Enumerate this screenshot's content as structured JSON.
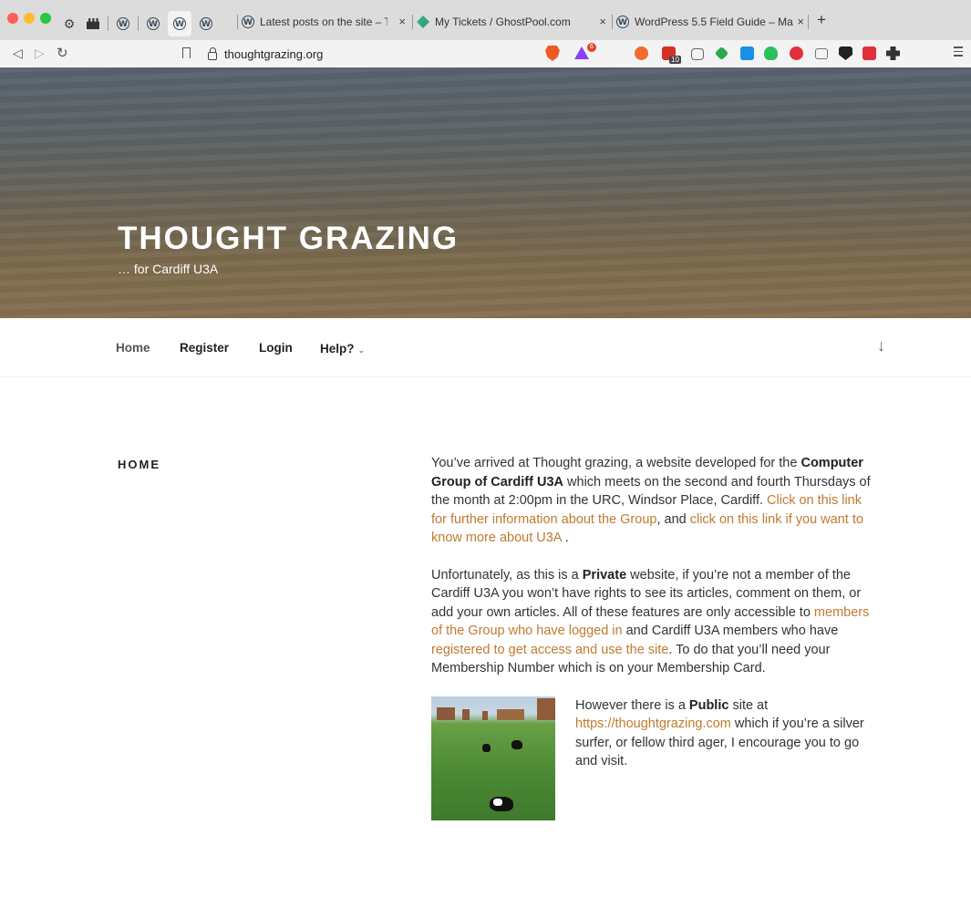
{
  "browser": {
    "tabs": [
      {
        "title": "Latest posts on the site – Thoug",
        "close": "×"
      },
      {
        "title": "My Tickets / GhostPool.com",
        "close": "×"
      },
      {
        "title": "WordPress 5.5 Field Guide – Ma",
        "close": "×"
      }
    ],
    "new_tab": "+",
    "url": "thoughtgrazing.org",
    "rewards_badge": "6",
    "ext_badge": "10"
  },
  "site": {
    "title": "THOUGHT GRAZING",
    "description": "… for Cardiff U3A"
  },
  "nav": {
    "items": [
      {
        "label": "Home"
      },
      {
        "label": "Register"
      },
      {
        "label": "Login"
      },
      {
        "label": "Help?"
      }
    ],
    "help_chevron": "⌄",
    "scroll_arrow": "↓"
  },
  "page": {
    "heading": "HOME",
    "p1": {
      "t1": "You’ve arrived at Thought grazing, a website developed for the ",
      "b1": "Computer Group of Cardiff U3A",
      "t2": " which meets on the second and fourth Thursdays of the month at 2:00pm in the URC, Windsor Place, Cardiff. ",
      "link1": "Click on this link for further information about the Group",
      "t3": ",  and ",
      "link2": "click on this link if you want to know more about U3A",
      "t4": " ."
    },
    "p2": {
      "t1": "Unfortunately, as this is a ",
      "b1": "Private",
      "t2": " website, if you’re not a member of the Cardiff U3A you won’t have rights to see its articles, comment on them, or add your own articles. All of these features are only accessible to ",
      "link1": "members of the Group who have logged in",
      "t3": " and Cardiff U3A members who have ",
      "link2": "registered to get access and use the site",
      "t4": ". To do that you’ll need your Membership Number which is on your Membership Card."
    },
    "p3": {
      "t1": "However there is a ",
      "b1": "Public",
      "t2": " site at ",
      "link1": "https://thoughtgrazing.com",
      "t3": " which if you’re a silver surfer, or fellow third ager, I encourage you to go and visit."
    }
  }
}
